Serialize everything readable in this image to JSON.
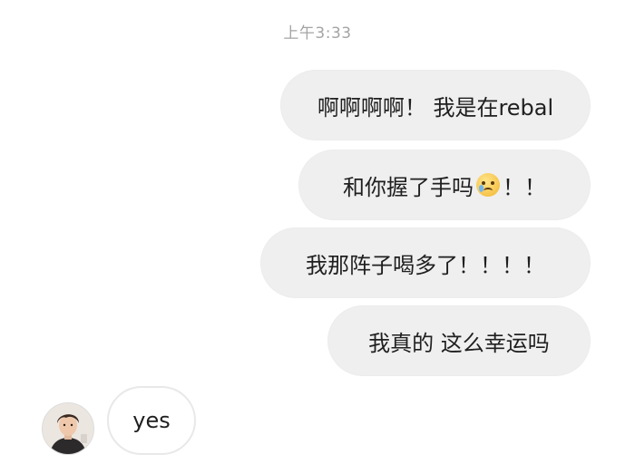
{
  "timestamp": "上午3:33",
  "messages_out": [
    {
      "text": "啊啊啊啊！ 我是在rebal"
    },
    {
      "text_before": "和你握了手吗",
      "emoji": "crying-face-icon",
      "text_after": "！！"
    },
    {
      "text": "我那阵子喝多了！！！！"
    },
    {
      "text": "我真的 这么幸运吗"
    }
  ],
  "message_in": {
    "text": "yes",
    "avatar": "avatar-icon"
  },
  "colors": {
    "outgoing_bubble": "#efefef",
    "incoming_bubble_border": "#e8e8e8",
    "timestamp": "#a4a4a4",
    "text": "#1f1f1f"
  }
}
